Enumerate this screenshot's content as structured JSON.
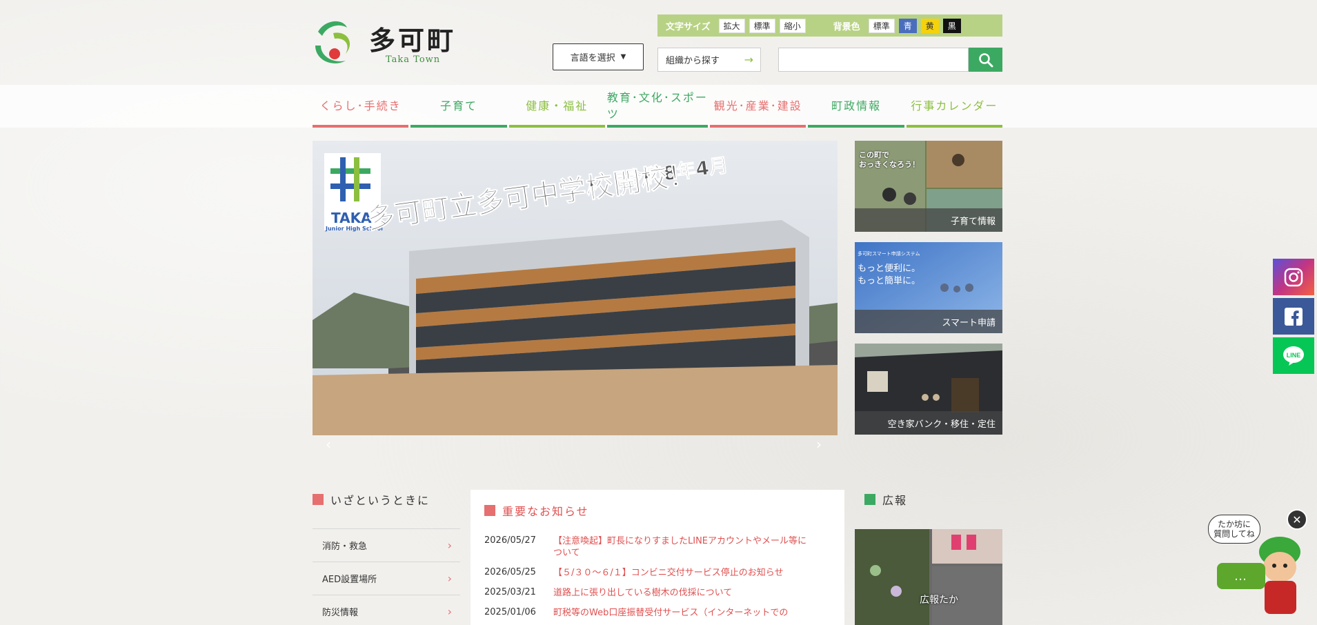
{
  "logo": {
    "title": "多可町",
    "subtitle": "Taka Town"
  },
  "accessibility": {
    "font_size_label": "文字サイズ",
    "font_size_options": [
      "拡大",
      "標準",
      "縮小"
    ],
    "bg_color_label": "背景色",
    "bg_color_options": [
      "標準",
      "青",
      "黄",
      "黒"
    ]
  },
  "header": {
    "language_select": "言語を選択",
    "org_search": "組織から探す",
    "search_placeholder": ""
  },
  "nav": {
    "items": [
      {
        "label": "くらし･手続き",
        "color": "#e66f6f"
      },
      {
        "label": "子育て",
        "color": "#3ca962"
      },
      {
        "label": "健康・福祉",
        "color": "#8cbf3f"
      },
      {
        "label": "教育･文化･スポーツ",
        "color": "#3ca962"
      },
      {
        "label": "観光･産業･建設",
        "color": "#e66f6f"
      },
      {
        "label": "町政情報",
        "color": "#3ca962"
      },
      {
        "label": "行事カレンダー",
        "color": "#8cbf3f"
      }
    ]
  },
  "hero": {
    "badge_name": "TAKA",
    "badge_sub": "Junior High School",
    "headline_small": "令和8年4月",
    "headline_big": "多可町立多可中学校開校！"
  },
  "side_banners": [
    {
      "caption": "子育て情報",
      "overlay": "この町で\nおっきくなろう！"
    },
    {
      "caption": "スマート申請",
      "small_title": "多可町スマート申請システム",
      "line1": "もっと便利に。",
      "line2": "もっと簡単に。"
    },
    {
      "caption": "空き家バンク・移住・定住"
    }
  ],
  "emergency": {
    "title": "いざというときに",
    "items": [
      "消防・救急",
      "AED設置場所",
      "防災情報"
    ]
  },
  "news": {
    "title": "重要なお知らせ",
    "items": [
      {
        "date": "2026/05/27",
        "text": "【注意喚起】町長になりすましたLINEアカウントやメール等について"
      },
      {
        "date": "2026/05/25",
        "text": "【５/３０～６/１】コンビニ交付サービス停止のお知らせ"
      },
      {
        "date": "2025/03/21",
        "text": "道路上に張り出している樹木の伐採について"
      },
      {
        "date": "2025/01/06",
        "text": "町税等のWeb口座振替受付サービス（インターネットでの"
      }
    ]
  },
  "koho": {
    "title": "広報",
    "caption": "広報たか"
  },
  "chat": {
    "bubble": "たか坊に\n質問してね",
    "dots": "…"
  },
  "social": [
    "instagram",
    "facebook",
    "line"
  ],
  "colors": {
    "green": "#3ca962",
    "red": "#e66f6f",
    "lime": "#8cbf3f",
    "access_bar": "#b8d285"
  }
}
